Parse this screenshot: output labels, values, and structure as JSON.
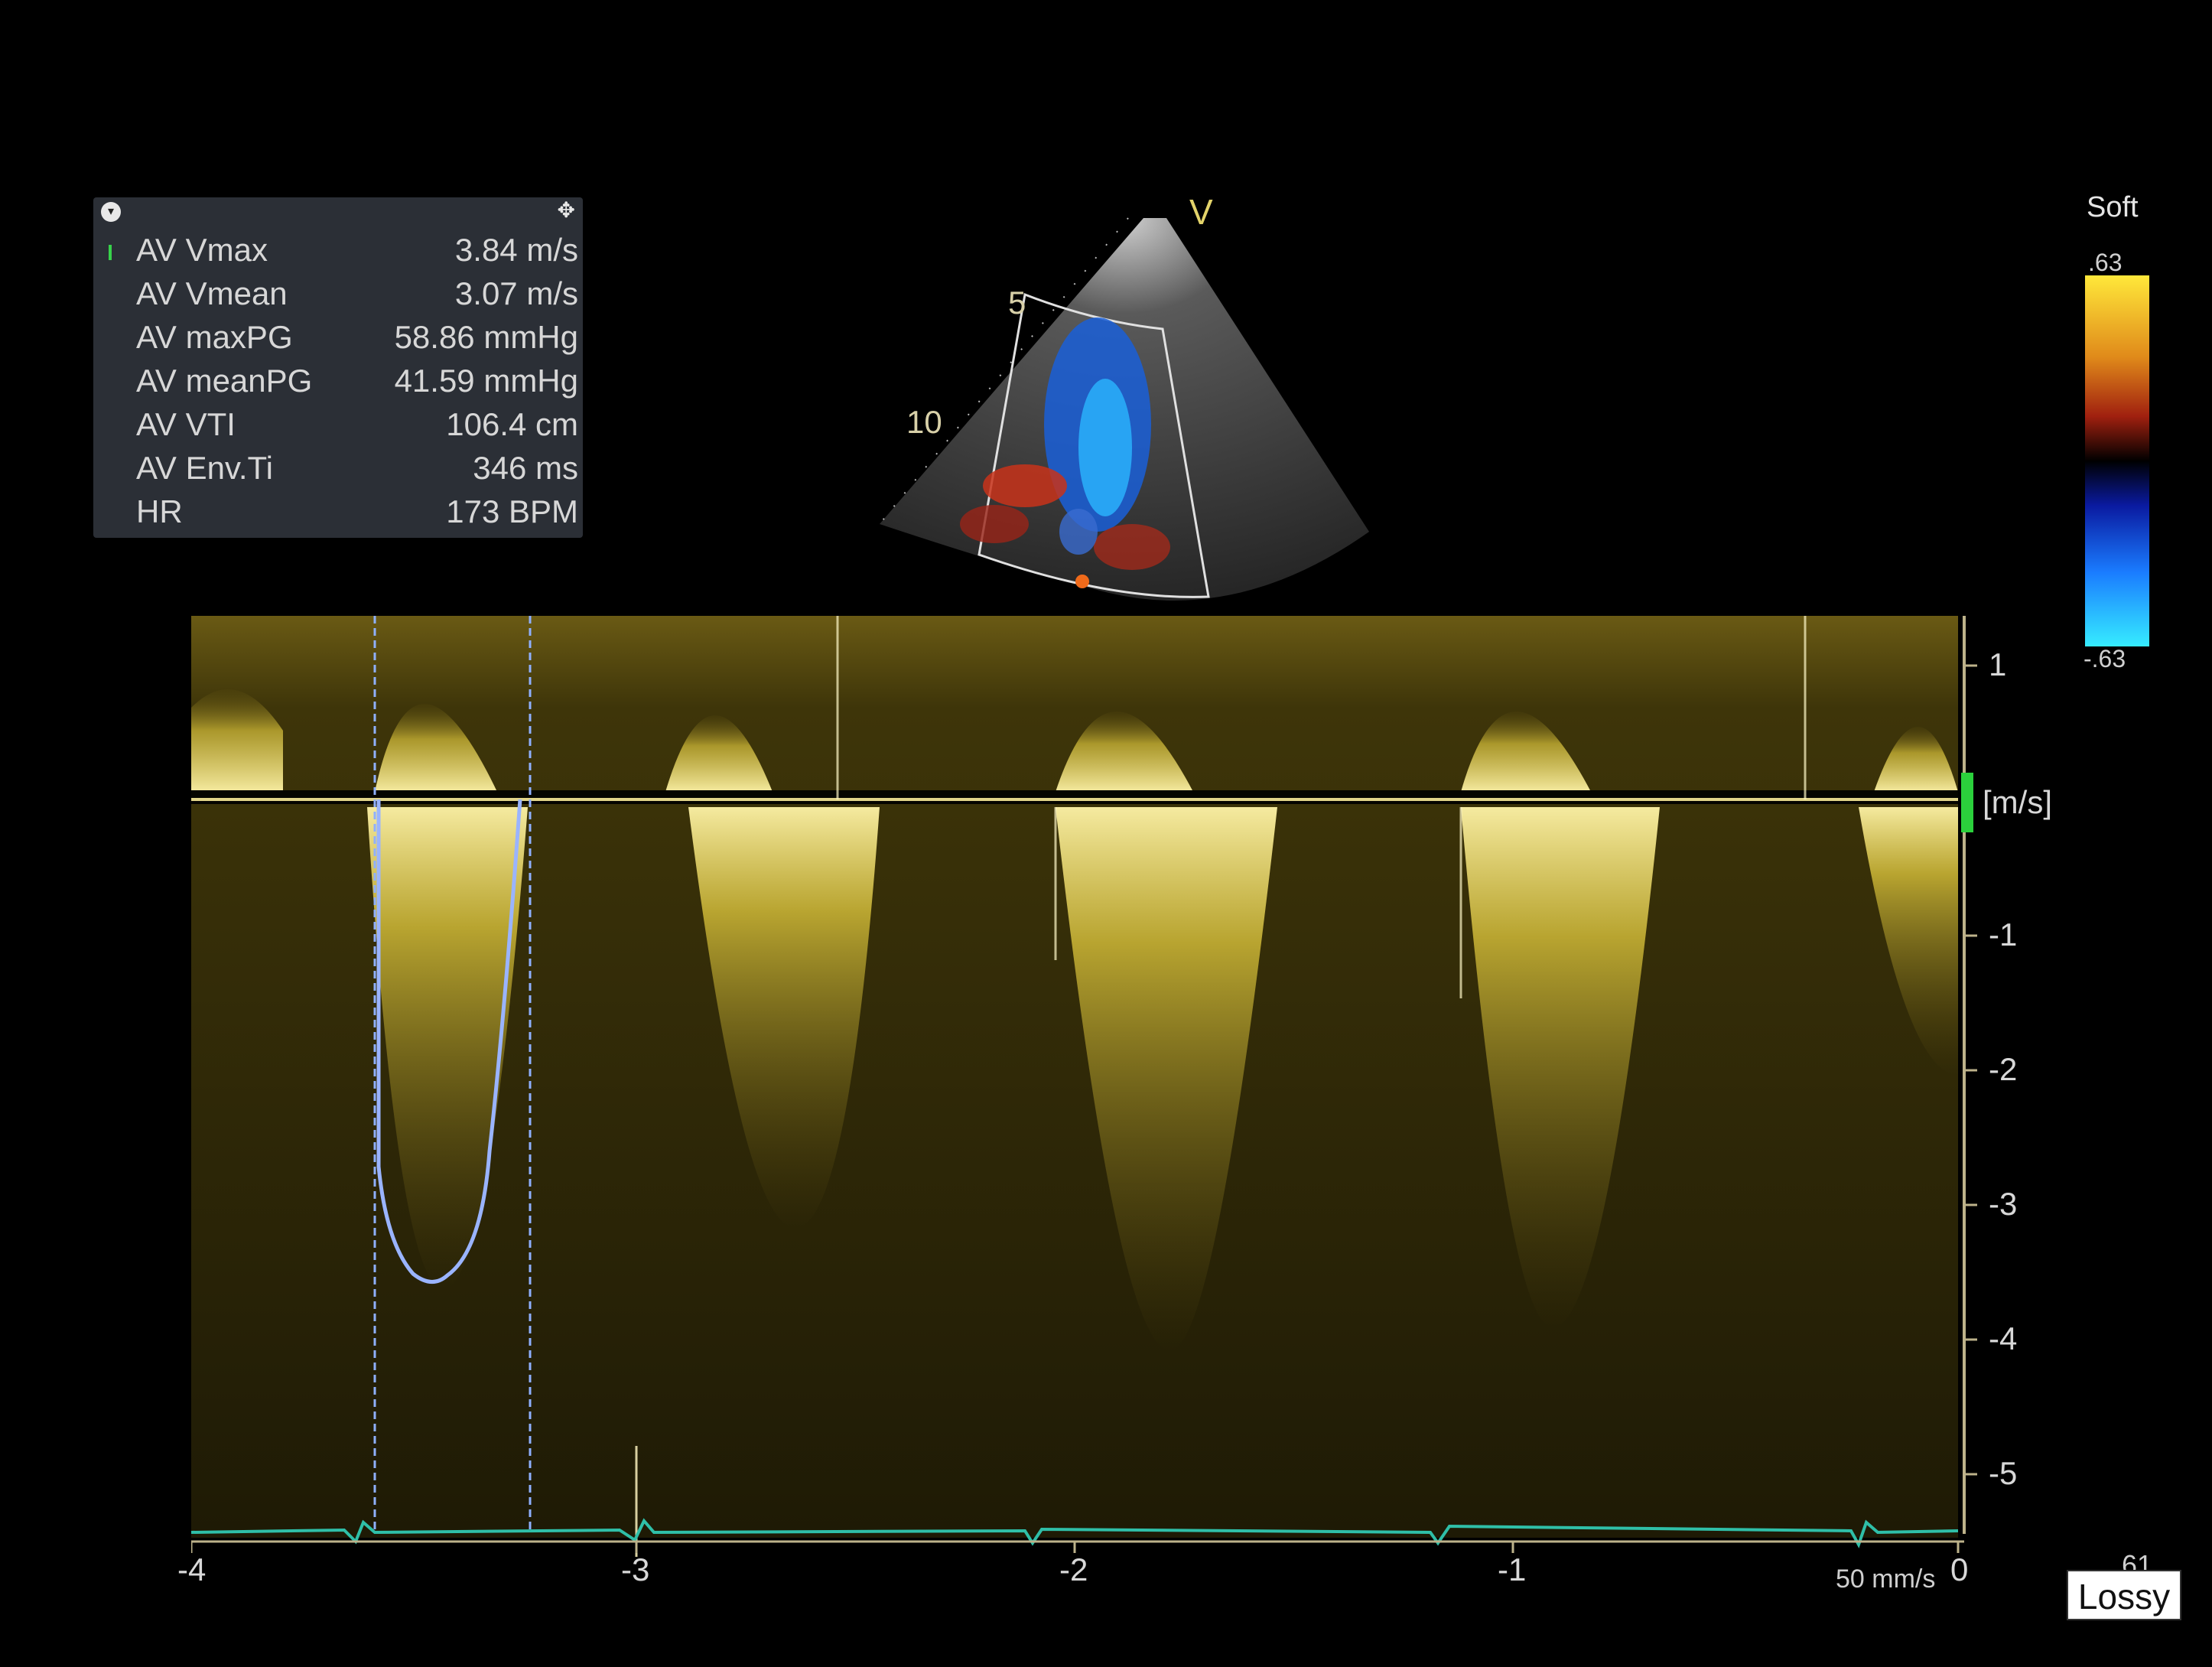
{
  "measurements": {
    "items": [
      {
        "label": "AV Vmax",
        "value": "3.84 m/s"
      },
      {
        "label": "AV Vmean",
        "value": "3.07 m/s"
      },
      {
        "label": "AV maxPG",
        "value": "58.86 mmHg"
      },
      {
        "label": "AV meanPG",
        "value": "41.59 mmHg"
      },
      {
        "label": "AV VTI",
        "value": "106.4 cm"
      },
      {
        "label": "AV Env.Ti",
        "value": "346 ms"
      },
      {
        "label": "HR",
        "value": "173 BPM"
      }
    ]
  },
  "sector": {
    "orientation_marker": "V",
    "depth_labels": [
      "5",
      "10"
    ]
  },
  "color_scale": {
    "name": "Soft",
    "top": ".63",
    "bottom": "-.63",
    "colors": {
      "top": "#ffe83a",
      "mid_pos": "#c4361a",
      "zero": "#000000",
      "mid_neg": "#1530c8",
      "bottom": "#2fe8ff"
    }
  },
  "spectral": {
    "velocity_ticks": [
      "1",
      "-1",
      "-2",
      "-3",
      "-4",
      "-5"
    ],
    "velocity_unit": "[m/s]",
    "time_ticks": [
      "-4",
      "-3",
      "-2",
      "-1",
      "0"
    ],
    "sweep_speed": "50 mm/s",
    "corner_value": "61",
    "envelope_peak_velocity_ms": -3.84,
    "doppler_color": "#d9c23a",
    "trace_color": "#9ab4ff",
    "ecg_color": "#2fbfa8"
  },
  "badge": "Lossy"
}
